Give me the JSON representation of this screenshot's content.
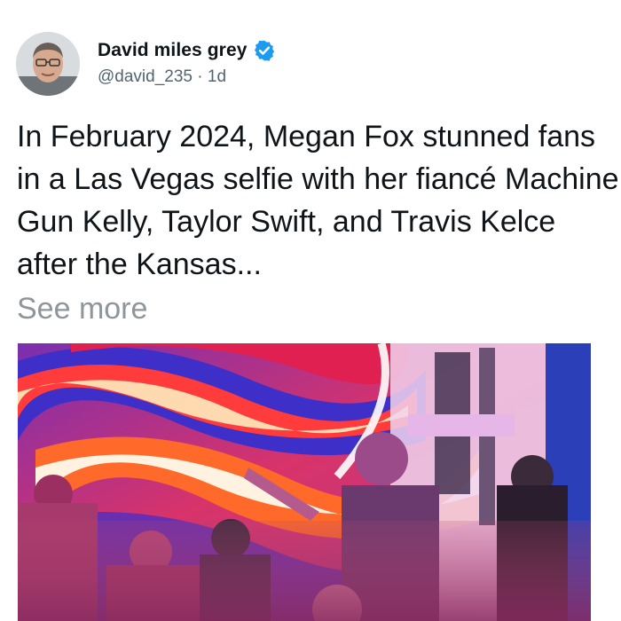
{
  "post": {
    "author_name": "David miles grey",
    "handle": "@david_235",
    "separator": "·",
    "time_ago": "1d",
    "verified": true,
    "text": "In February 2024, Megan Fox stunned fans in a Las Vegas selfie with her fiancé Machine Gun Kelly, Taylor Swift, and Travis Kelce after the Kansas...",
    "see_more_label": "See more"
  },
  "icons": {
    "verified": "verified-badge-icon"
  },
  "colors": {
    "text": "#0f1419",
    "secondary": "#536471",
    "see_more": "#8e959b",
    "verified_blue": "#1d9bf0"
  }
}
